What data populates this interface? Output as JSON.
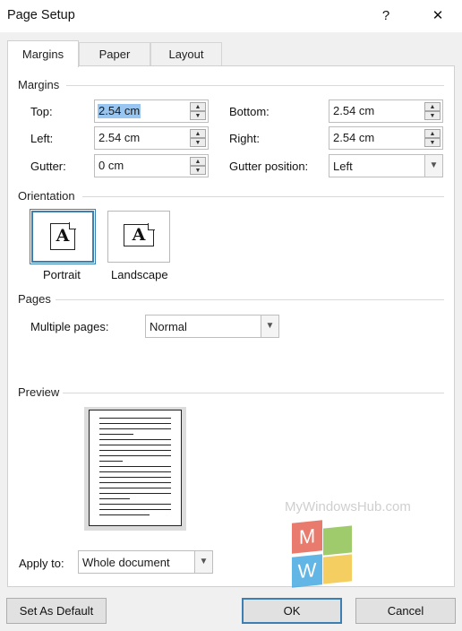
{
  "window": {
    "title": "Page Setup",
    "help_glyph": "?",
    "close_glyph": "✕"
  },
  "tabs": [
    {
      "label": "Margins",
      "active": true
    },
    {
      "label": "Paper",
      "active": false
    },
    {
      "label": "Layout",
      "active": false
    }
  ],
  "margins": {
    "group_label": "Margins",
    "top": {
      "label": "Top:",
      "value": "2.54 cm"
    },
    "bottom": {
      "label": "Bottom:",
      "value": "2.54 cm"
    },
    "left": {
      "label": "Left:",
      "value": "2.54 cm"
    },
    "right": {
      "label": "Right:",
      "value": "2.54 cm"
    },
    "gutter": {
      "label": "Gutter:",
      "value": "0 cm"
    },
    "gutter_position": {
      "label": "Gutter position:",
      "value": "Left"
    }
  },
  "orientation": {
    "group_label": "Orientation",
    "portrait": {
      "label": "Portrait",
      "glyph": "A",
      "selected": true
    },
    "landscape": {
      "label": "Landscape",
      "glyph": "A",
      "selected": false
    }
  },
  "pages": {
    "group_label": "Pages",
    "multiple_pages_label": "Multiple pages:",
    "multiple_pages_value": "Normal"
  },
  "preview": {
    "group_label": "Preview"
  },
  "apply_to": {
    "label": "Apply to:",
    "value": "Whole document"
  },
  "buttons": {
    "set_default": "Set As Default",
    "ok": "OK",
    "cancel": "Cancel"
  },
  "watermark": {
    "text": "MyWindowsHub.com",
    "letter_m": "M",
    "letter_w": "W",
    "colors": {
      "red": "#e35b4a",
      "green": "#7fba3c",
      "blue": "#3ba5e0",
      "yellow": "#f3c23a"
    }
  },
  "colors": {
    "accent": "#3c7fb1",
    "selection": "#99c6f0"
  }
}
